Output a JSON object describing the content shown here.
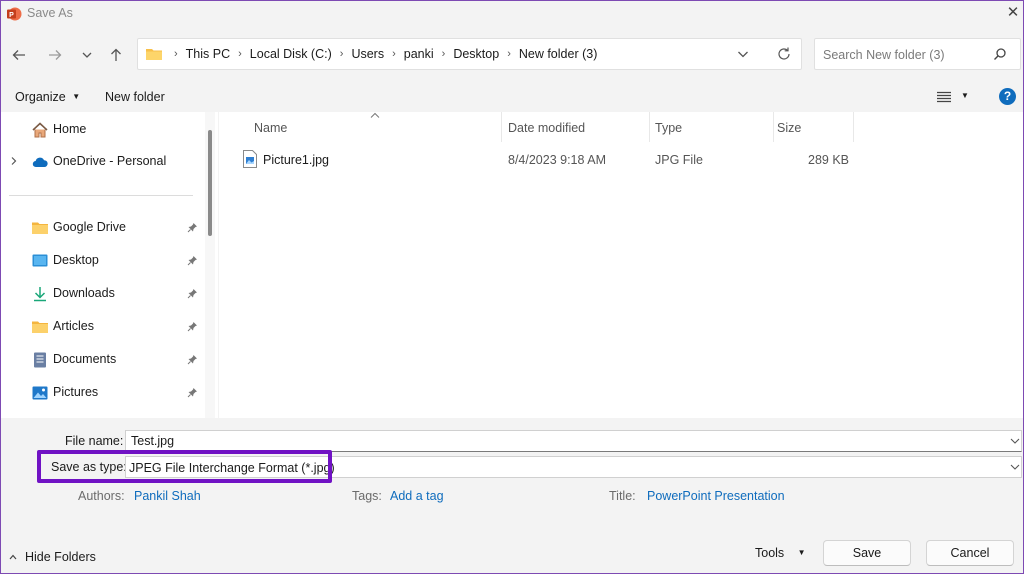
{
  "window": {
    "title": "Save As",
    "app_icon": "powerpoint-icon",
    "accent": "#c43e1c"
  },
  "nav": {
    "back": "back-arrow-icon",
    "forward": "forward-arrow-icon",
    "recent": "chevron-down-icon",
    "up": "up-arrow-icon"
  },
  "address": {
    "crumbs": [
      "This PC",
      "Local Disk (C:)",
      "Users",
      "panki",
      "Desktop",
      "New folder (3)"
    ]
  },
  "search": {
    "placeholder": "Search New folder (3)"
  },
  "toolbar": {
    "organize_label": "Organize",
    "new_folder_label": "New folder",
    "help_label": "?"
  },
  "sidebar": {
    "items": [
      {
        "label": "Home",
        "icon": "home-icon"
      },
      {
        "label": "OneDrive - Personal",
        "icon": "onedrive-cloud-icon"
      },
      {
        "label": "Google Drive",
        "icon": "folder-icon",
        "pinned": true
      },
      {
        "label": "Desktop",
        "icon": "desktop-icon",
        "pinned": true
      },
      {
        "label": "Downloads",
        "icon": "download-icon",
        "pinned": true
      },
      {
        "label": "Articles",
        "icon": "folder-icon",
        "pinned": true
      },
      {
        "label": "Documents",
        "icon": "documents-icon",
        "pinned": true
      },
      {
        "label": "Pictures",
        "icon": "pictures-icon",
        "pinned": true
      }
    ]
  },
  "files": {
    "columns": [
      "Name",
      "Date modified",
      "Type",
      "Size"
    ],
    "rows": [
      {
        "name": "Picture1.jpg",
        "date": "8/4/2023 9:18 AM",
        "type": "JPG File",
        "size": "289 KB"
      }
    ]
  },
  "form": {
    "file_name_label": "File name:",
    "file_name_value": "Test.jpg",
    "save_type_label": "Save as type:",
    "save_type_value": "JPEG File Interchange Format (*.jpg)",
    "authors_label": "Authors:",
    "authors_value": "Pankil Shah",
    "tags_label": "Tags:",
    "tags_value": "Add a tag",
    "title_label": "Title:",
    "title_value": "PowerPoint Presentation",
    "highlight_color": "#7012c4"
  },
  "footer": {
    "hide_folders_label": "Hide Folders",
    "tools_label": "Tools",
    "save_label": "Save",
    "cancel_label": "Cancel"
  }
}
